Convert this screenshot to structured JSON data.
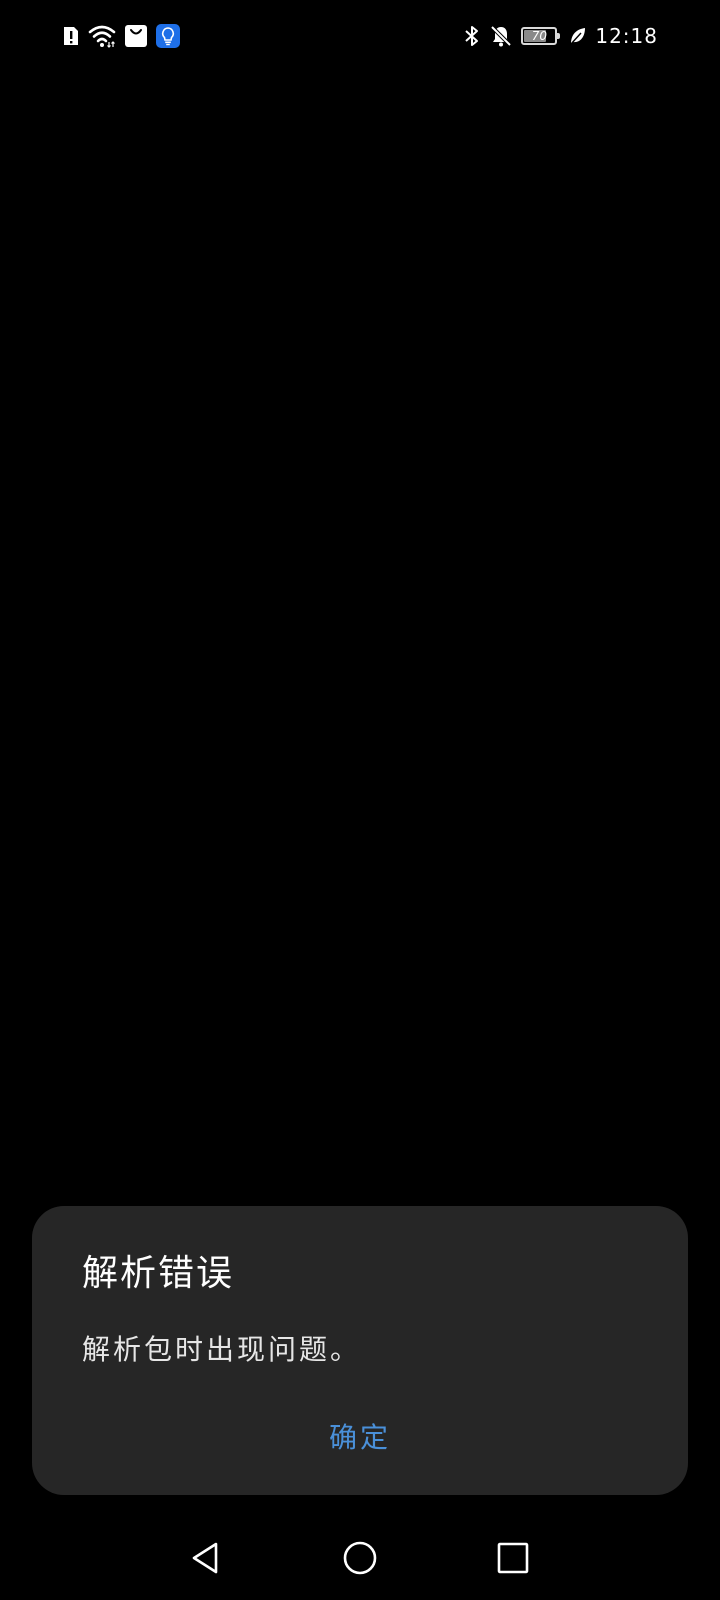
{
  "status_bar": {
    "left_icons": [
      "alert-sim-icon",
      "wifi-icon",
      "shopping-bag-icon",
      "lightbulb-app-icon"
    ],
    "right_icons": [
      "bluetooth-icon",
      "bell-off-icon",
      "battery-icon",
      "leaf-icon"
    ],
    "battery_level": "70",
    "time": "12:18"
  },
  "dialog": {
    "title": "解析错误",
    "message": "解析包时出现问题。",
    "ok_label": "确定"
  },
  "nav_bar": {
    "buttons": [
      "back-icon",
      "home-icon",
      "recents-icon"
    ]
  },
  "colors": {
    "background": "#000000",
    "dialog_background": "#262626",
    "accent": "#4a90d9",
    "icon": "#ffffff"
  }
}
